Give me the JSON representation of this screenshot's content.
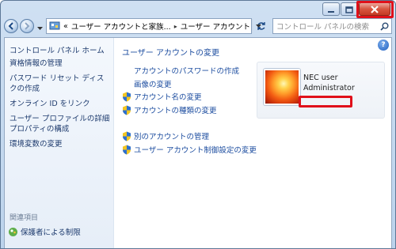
{
  "window": {
    "caption_buttons": {
      "minimize_icon": "minimize-icon",
      "maximize_icon": "maximize-icon",
      "close_icon": "close-icon"
    }
  },
  "toolbar": {
    "address_segments": [
      "«",
      "ユーザー アカウントと家族...",
      "ユーザー アカウント"
    ],
    "search_placeholder": "コントロール パネルの検索"
  },
  "sidebar": {
    "home": "コントロール パネル ホーム",
    "items": [
      "資格情報の管理",
      "パスワード リセット ディスクの作成",
      "オンライン ID をリンク",
      "ユーザー プロファイルの詳細プロパティの構成",
      "環境変数の変更"
    ],
    "related_title": "関連項目",
    "related_link": "保護者による制限"
  },
  "main": {
    "title": "ユーザー アカウントの変更",
    "tasks_1": [
      {
        "label": "アカウントのパスワードの作成",
        "shield": false
      },
      {
        "label": "画像の変更",
        "shield": false
      },
      {
        "label": "アカウント名の変更",
        "shield": true
      },
      {
        "label": "アカウントの種類の変更",
        "shield": true
      }
    ],
    "tasks_2": [
      {
        "label": "別のアカウントの管理",
        "shield": true
      },
      {
        "label": "ユーザー アカウント制御設定の変更",
        "shield": true
      }
    ],
    "user": {
      "name": "NEC user",
      "role": "Administrator"
    }
  },
  "colors": {
    "highlight": "#e0101a",
    "link": "#1e4ea0"
  }
}
